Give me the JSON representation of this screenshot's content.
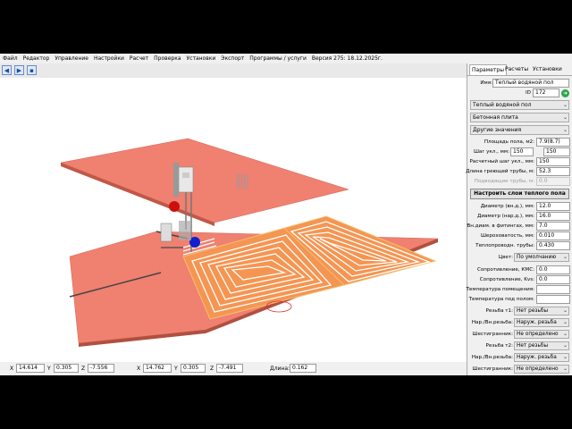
{
  "menu": [
    "Файл",
    "Редактор",
    "Управление",
    "Настройки",
    "Расчет",
    "Проверка",
    "Установки",
    "Экспорт",
    "Программы / услуги",
    "Версия 275: 18.12.2025г."
  ],
  "toolbar": {
    "icons": [
      "back-arrow-icon",
      "forward-arrow-icon",
      "save-icon"
    ]
  },
  "colors": {
    "slab": "#f08070",
    "pipe_area": "#f59552",
    "pipe": "#ffffff",
    "accent": "#2f7ed8"
  },
  "status": {
    "x1_label": "X",
    "x1": "14.614",
    "y1_label": "Y",
    "y1": "0.305",
    "z1_label": "Z",
    "z1": "-7.556",
    "x2_label": "X",
    "x2": "14.762",
    "y2_label": "Y",
    "y2": "0.305",
    "z2_label": "Z",
    "z2": "-7.491",
    "len_label": "Длина:",
    "len": "0.162"
  },
  "panel": {
    "tabs": [
      "Параметры",
      "Расчеты",
      "Установки"
    ],
    "name_label": "Имя:",
    "name_value": "Теплый водяной пол",
    "id_label": "ID",
    "id_value": "172",
    "dropdown1": "Теплый водяной пол",
    "dropdown2": "Бетонная плита",
    "dropdown3": "Другие значения",
    "fields1": [
      {
        "label": "Площадь пола, м2:",
        "value": "7.9(8.7)",
        "disabled": false
      },
      {
        "label": "Шаг укл., мм:",
        "value": "150",
        "value2": "150",
        "disabled": false
      },
      {
        "label": "Расчетный шаг укл., мм:",
        "value": "150",
        "disabled": false
      },
      {
        "label": "Длина греющей трубы, м:",
        "value": "52.3",
        "disabled": false
      },
      {
        "label": "Подводящие трубы, м:",
        "value": "0.0",
        "disabled": true
      }
    ],
    "layers_button": "Настроить слои теплого пола",
    "fields2": [
      {
        "label": "Диаметр (вн.д.), мм:",
        "value": "12.0"
      },
      {
        "label": "Диаметр (нар.д.), мм:",
        "value": "16.0"
      },
      {
        "label": "Вн.диам. в фитингах, мм:",
        "value": "7.0"
      },
      {
        "label": "Шероховатость, мм:",
        "value": "0.010"
      },
      {
        "label": "Теплопроводн. трубы:",
        "value": "0.430"
      }
    ],
    "color_label": "Цвет:",
    "color_value": "По умолчанию",
    "fields3": [
      {
        "label": "Сопротивление, КМС:",
        "value": "0.0"
      },
      {
        "label": "Сопротивление, Kvs:",
        "value": "0.0"
      },
      {
        "label": "Температура помещения:",
        "value": ""
      },
      {
        "label": "Температура под полом:",
        "value": ""
      }
    ],
    "selects": [
      {
        "label": "Резьба т1:",
        "value": "Нет резьбы"
      },
      {
        "label": "Нар./Вн.резьба:",
        "value": "Наруж. резьба"
      },
      {
        "label": "Шестигранник:",
        "value": "Не определено"
      },
      {
        "label": "Резьба т2:",
        "value": "Нет резьбы"
      },
      {
        "label": "Нар./Вн.резьба:",
        "value": "Наруж. резьба"
      },
      {
        "label": "Шестигранник:",
        "value": "Не определено"
      }
    ]
  }
}
